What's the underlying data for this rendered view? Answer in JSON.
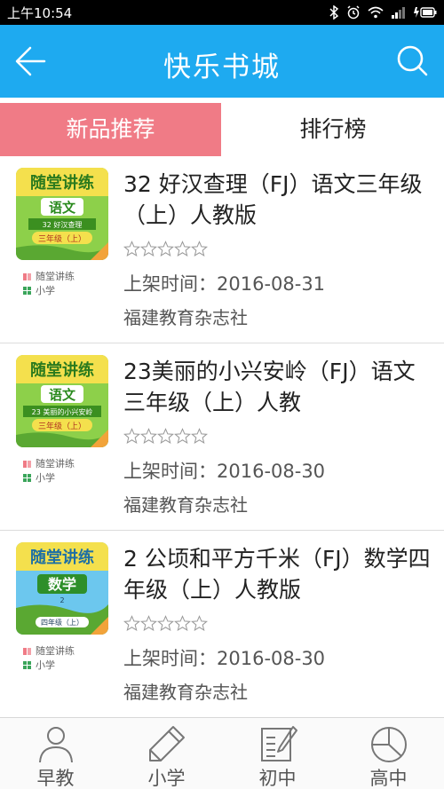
{
  "status_bar": {
    "time": "上午10:54"
  },
  "header": {
    "title": "快乐书城"
  },
  "tabs": [
    {
      "label": "新品推荐",
      "active": true
    },
    {
      "label": "排行榜",
      "active": false
    }
  ],
  "books": [
    {
      "title": "32 好汉查理（FJ）语文三年级（上）人教版",
      "series_tag": "随堂讲练",
      "level_tag": "小学",
      "release": "上架时间：2016-08-31",
      "publisher": "福建教育杂志社",
      "rating": 0,
      "cover": {
        "header": "随堂讲练",
        "subject": "语文",
        "lesson": "32 好汉查理",
        "grade": "三年级（上）",
        "theme": "#7cc63a"
      }
    },
    {
      "title": "23美丽的小兴安岭（FJ）语文三年级（上）人教",
      "series_tag": "随堂讲练",
      "level_tag": "小学",
      "release": "上架时间：2016-08-30",
      "publisher": "福建教育杂志社",
      "rating": 0,
      "cover": {
        "header": "随堂讲练",
        "subject": "语文",
        "lesson": "23 美丽的小兴安岭",
        "grade": "三年级（上）",
        "theme": "#7cc63a"
      }
    },
    {
      "title": "2 公顷和平方千米（FJ）数学四年级（上）人教版",
      "series_tag": "随堂讲练",
      "level_tag": "小学",
      "release": "上架时间：2016-08-30",
      "publisher": "福建教育杂志社",
      "rating": 0,
      "cover": {
        "header": "随堂讲练",
        "subject": "数学",
        "lesson": "2",
        "grade": "四年级（上）",
        "theme": "#2ea6d8"
      }
    }
  ],
  "bottom_nav": [
    {
      "label": "早教",
      "icon": "person-icon"
    },
    {
      "label": "小学",
      "icon": "pencil-icon"
    },
    {
      "label": "初中",
      "icon": "notebook-icon"
    },
    {
      "label": "高中",
      "icon": "pie-chart-icon"
    }
  ],
  "colors": {
    "header": "#1eaaf0",
    "active_tab": "#f07b86"
  }
}
